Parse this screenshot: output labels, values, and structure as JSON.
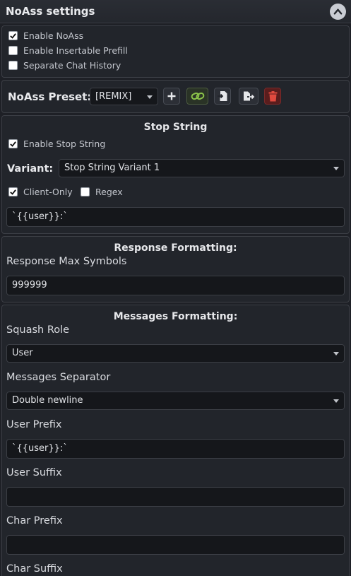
{
  "header": {
    "title": "NoAss settings"
  },
  "toggles": [
    {
      "label": "Enable NoAss",
      "checked": true
    },
    {
      "label": "Enable Insertable Prefill",
      "checked": false
    },
    {
      "label": "Separate Chat History",
      "checked": false
    }
  ],
  "preset": {
    "label": "NoAss Preset:",
    "value": "[REMIX]"
  },
  "stop_string": {
    "title": "Stop String",
    "enable_label": "Enable Stop String",
    "variant_label": "Variant:",
    "variant_value": "Stop String Variant 1",
    "client_only_label": "Client-Only",
    "regex_label": "Regex",
    "value": "`{{user}}:`"
  },
  "response": {
    "title": "Response Formatting:",
    "max_symbols_label": "Response Max Symbols",
    "max_symbols_value": "999999"
  },
  "messages": {
    "title": "Messages Formatting:",
    "squash_role_label": "Squash Role",
    "squash_role_value": "User",
    "separator_label": "Messages Separator",
    "separator_value": "Double newline",
    "user_prefix_label": "User Prefix",
    "user_prefix_value": "`{{user}}:`",
    "user_suffix_label": "User Suffix",
    "user_suffix_value": "",
    "char_prefix_label": "Char Prefix",
    "char_prefix_value": "",
    "char_suffix_label": "Char Suffix"
  },
  "colors": {
    "link_green": "#8bc34a",
    "delete_red": "#c0392b"
  }
}
